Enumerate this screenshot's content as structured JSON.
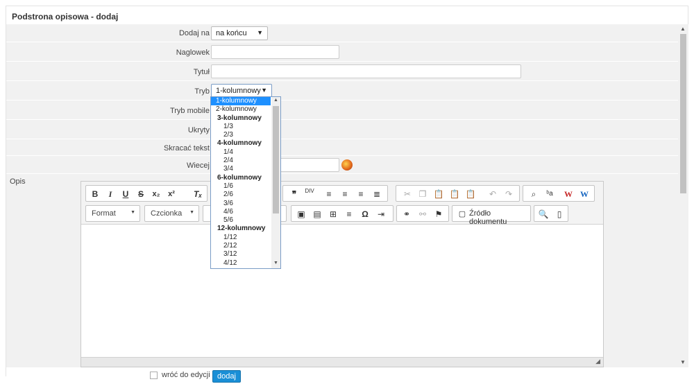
{
  "title": "Podstrona opisowa - dodaj",
  "fields": {
    "dodaj_na": {
      "label": "Dodaj na",
      "value": "na końcu"
    },
    "naglowek": {
      "label": "Naglowek",
      "value": ""
    },
    "tytul": {
      "label": "Tytuł",
      "value": ""
    },
    "tryb": {
      "label": "Tryb",
      "value": "1-kolumnowy"
    },
    "tryb_mobile": {
      "label": "Tryb mobile"
    },
    "ukryty": {
      "label": "Ukryty"
    },
    "skracac": {
      "label": "Skracać tekst"
    },
    "wiecej": {
      "label": "Wiecej",
      "value": ""
    },
    "opis": {
      "label": "Opis"
    }
  },
  "editor": {
    "format_label": "Format",
    "font_label": "Czcionka",
    "source_label": "Źródło dokumentu"
  },
  "dropdown": {
    "options": [
      {
        "text": "1-kolumnowy",
        "kind": "opt",
        "selected": true
      },
      {
        "text": "2-kolumnowy",
        "kind": "opt"
      },
      {
        "text": "3-kolumnowy",
        "kind": "grp"
      },
      {
        "text": "1/3",
        "kind": "sub"
      },
      {
        "text": "2/3",
        "kind": "sub"
      },
      {
        "text": "4-kolumnowy",
        "kind": "grp"
      },
      {
        "text": "1/4",
        "kind": "sub"
      },
      {
        "text": "2/4",
        "kind": "sub"
      },
      {
        "text": "3/4",
        "kind": "sub"
      },
      {
        "text": "6-kolumnowy",
        "kind": "grp"
      },
      {
        "text": "1/6",
        "kind": "sub"
      },
      {
        "text": "2/6",
        "kind": "sub"
      },
      {
        "text": "3/6",
        "kind": "sub"
      },
      {
        "text": "4/6",
        "kind": "sub"
      },
      {
        "text": "5/6",
        "kind": "sub"
      },
      {
        "text": "12-kolumnowy",
        "kind": "grp"
      },
      {
        "text": "1/12",
        "kind": "sub"
      },
      {
        "text": "2/12",
        "kind": "sub"
      },
      {
        "text": "3/12",
        "kind": "sub"
      },
      {
        "text": "4/12",
        "kind": "sub"
      }
    ]
  },
  "footer": {
    "return_label": "wróć do edycji",
    "submit_label": "dodaj"
  }
}
